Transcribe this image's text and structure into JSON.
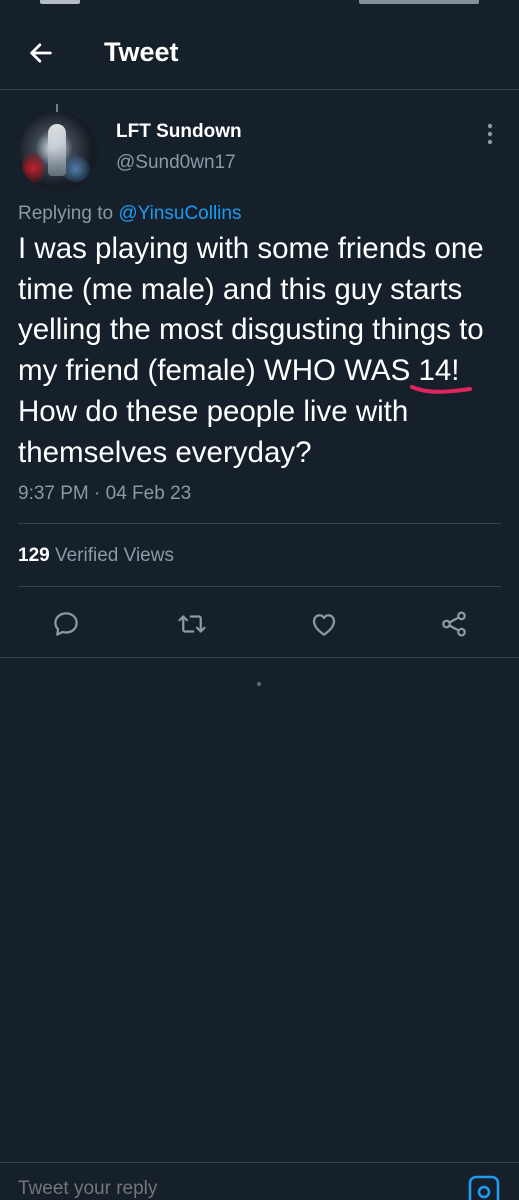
{
  "header": {
    "title": "Tweet"
  },
  "tweet": {
    "display_name": "LFT Sundown",
    "handle": "@Sund0wn17",
    "replying_prefix": "Replying to ",
    "replying_mention": "@YinsuCollins",
    "text_before": "I was playing with some friends one time (me male) and this guy starts yelling the most disgusting things to my friend (female) WHO WAS ",
    "text_highlight": "14!",
    "text_after": " How do these people live with themselves everyday?",
    "timestamp": "9:37 PM · 04 Feb 23",
    "views_count": "129",
    "views_label": " Verified Views"
  },
  "reply_bar": {
    "placeholder": "Tweet your reply"
  },
  "colors": {
    "background": "#15202b",
    "accent": "#1d9bf0",
    "secondary_text": "#8b98a5",
    "divider": "#38444d",
    "annotation": "#e0245e"
  },
  "icons": {
    "back": "arrow-left-icon",
    "more": "more-vertical-icon",
    "reply": "comment-icon",
    "retweet": "retweet-icon",
    "like": "heart-icon",
    "share": "share-icon",
    "camera": "camera-icon"
  }
}
